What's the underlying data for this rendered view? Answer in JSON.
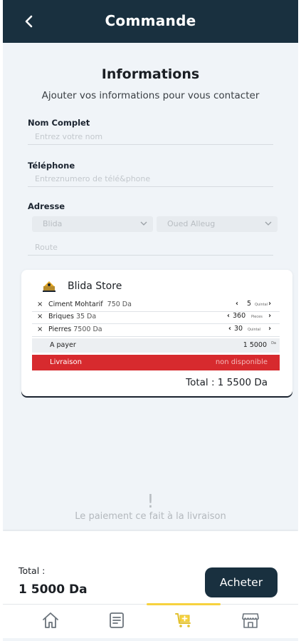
{
  "header": {
    "title": "Commande",
    "back_icon": "chevron-left-icon"
  },
  "informations": {
    "title": "Informations",
    "subtitle": "Ajouter vos informations pour vous contacter",
    "name_label": "Nom Complet",
    "name_placeholder": "Entrez votre nom",
    "phone_label": "Téléphone",
    "phone_placeholder": "Entreznumero de télé&phone",
    "address_label": "Adresse",
    "wilaya_value": "Blida",
    "commune_value": "Oued Alleug",
    "route_placeholder": "Route"
  },
  "store": {
    "name": "Blida Store",
    "items": [
      {
        "name": "Ciment Mohtarif",
        "price": "750 Da",
        "quantity": "5",
        "unit": "Quintal"
      },
      {
        "name": "Briques",
        "price": "35 Da",
        "quantity": "360",
        "unit": "Pieces"
      },
      {
        "name": "Pierres",
        "price": "7500 Da",
        "quantity": "30",
        "unit": "Quintal"
      }
    ],
    "pay_label": "A payer",
    "pay_value": "1 5000",
    "pay_currency": "Da",
    "delivery_label": "Livraison",
    "delivery_value": "non  disponible",
    "total_text": "Total :  1 5500 Da"
  },
  "payment_note": {
    "mark": "!",
    "text": "Le paiement ce fait à la livraison"
  },
  "footer": {
    "total_label": "Total :",
    "total_value": "1 5000 Da",
    "buy_label": "Acheter"
  },
  "navbar": {
    "items": [
      "home-icon",
      "orders-icon",
      "cart-icon",
      "store-icon"
    ],
    "active_index": 2,
    "active_color": "#f7d23e"
  },
  "colors": {
    "primary": "#19303f",
    "danger": "#d72a2e",
    "accent": "#f7d23e",
    "background": "#f0f4f8"
  }
}
